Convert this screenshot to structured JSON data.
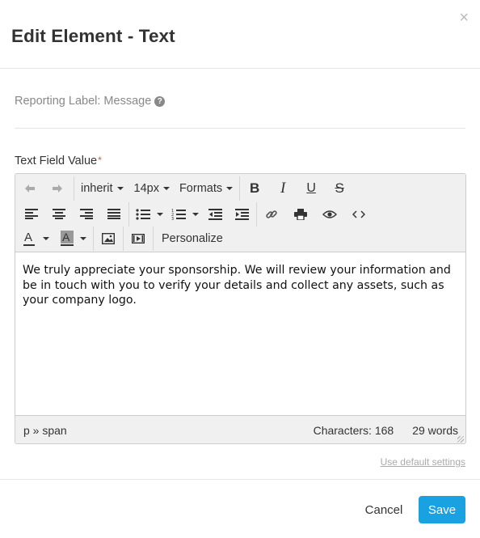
{
  "modal": {
    "title": "Edit Element - Text",
    "close_glyph": "×"
  },
  "reporting": {
    "label": "Reporting Label: Message",
    "help_glyph": "?"
  },
  "field": {
    "label": "Text Field Value",
    "required_mark": "*"
  },
  "toolbar": {
    "font_family": "inherit",
    "font_size": "14px",
    "formats": "Formats",
    "personalize": "Personalize",
    "icons": [
      "undo-icon",
      "redo-icon",
      "bold-icon",
      "italic-icon",
      "underline-icon",
      "strikethrough-icon",
      "align-left-icon",
      "align-center-icon",
      "align-right-icon",
      "align-justify-icon",
      "bullet-list-icon",
      "numbered-list-icon",
      "outdent-icon",
      "indent-icon",
      "link-icon",
      "print-icon",
      "preview-icon",
      "source-code-icon",
      "text-color-icon",
      "background-color-icon",
      "image-icon",
      "media-icon"
    ]
  },
  "editor": {
    "content": "We truly appreciate your sponsorship. We will review your information and be in touch with you to verify your details and collect any assets, such as your company logo."
  },
  "statusbar": {
    "path": "p » span",
    "characters": "Characters: 168",
    "words": "29 words"
  },
  "links": {
    "use_default": "Use default settings"
  },
  "buttons": {
    "cancel": "Cancel",
    "save": "Save"
  },
  "colors": {
    "primary": "#1aa1e2",
    "required": "#d9534f",
    "toolbar_bg": "#f0f0f0"
  }
}
